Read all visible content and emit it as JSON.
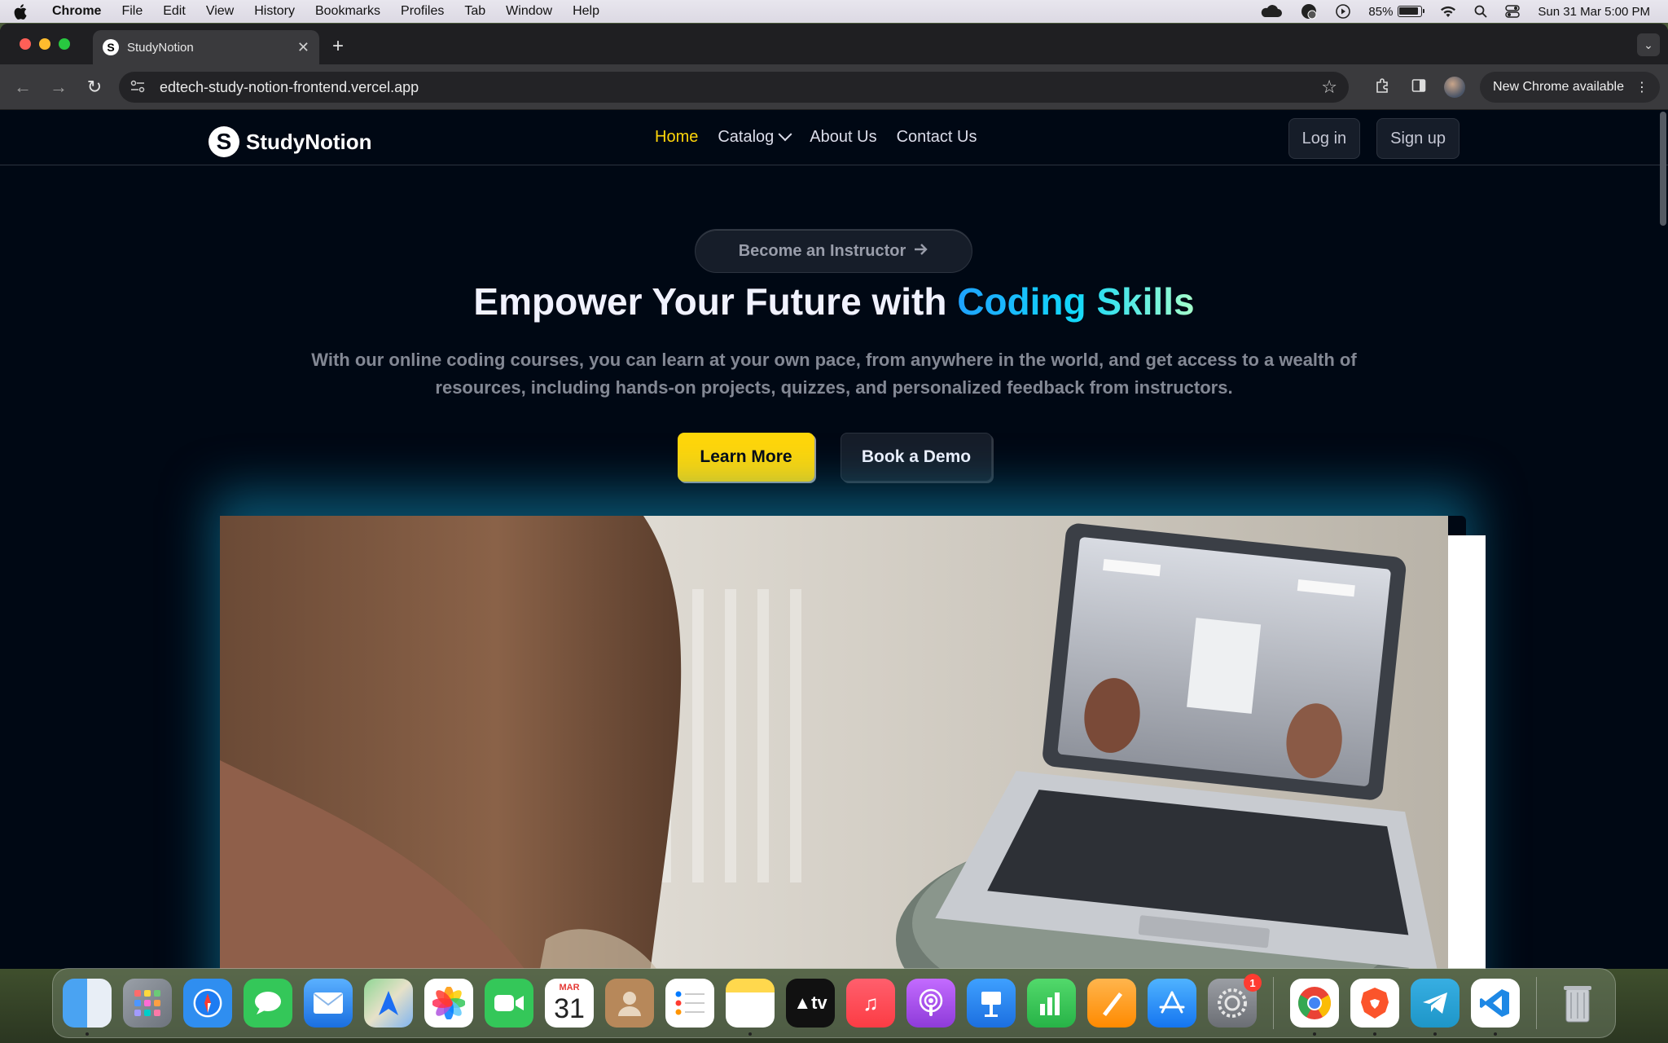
{
  "menubar": {
    "app": "Chrome",
    "items": [
      "File",
      "Edit",
      "View",
      "History",
      "Bookmarks",
      "Profiles",
      "Tab",
      "Window",
      "Help"
    ],
    "battery_percent": "85%",
    "battery_level": 0.85,
    "datetime": "Sun 31 Mar  5:00 PM",
    "status_icons": [
      "cloud-icon",
      "sync-icon",
      "play-icon",
      "wifi-icon",
      "search-icon",
      "control-center-icon"
    ]
  },
  "browser": {
    "tab": {
      "title": "StudyNotion",
      "favicon": "S"
    },
    "url": "edtech-study-notion-frontend.vercel.app",
    "update_button": "New Chrome available"
  },
  "site": {
    "logo": "StudyNotion",
    "logo_mark": "S",
    "nav": {
      "home": "Home",
      "catalog": "Catalog",
      "about": "About Us",
      "contact": "Contact Us"
    },
    "auth": {
      "login": "Log in",
      "signup": "Sign up"
    },
    "hero": {
      "pill": "Become an Instructor",
      "headline_prefix": "Empower Your Future with",
      "headline_highlight": "Coding Skills",
      "subtext": "With our online coding courses, you can learn at your own pace, from anywhere in the world, and get access to a wealth of resources, including hands-on projects, quizzes, and personalized feedback from instructors.",
      "cta_primary": "Learn More",
      "cta_secondary": "Book a Demo"
    },
    "colors": {
      "accent_yellow": "#FFD60A",
      "background": "#000814",
      "gradient_start": "#1FA2FF",
      "gradient_end": "#A6FFCB"
    }
  },
  "dock": {
    "calendar_month": "MAR",
    "calendar_day": "31",
    "settings_badge": "1",
    "tv_label": "tv",
    "apps": [
      "finder",
      "launchpad",
      "safari",
      "messages",
      "mail",
      "maps",
      "photos",
      "facetime",
      "calendar",
      "contacts",
      "reminders",
      "notes",
      "tv",
      "music",
      "podcasts",
      "keynote",
      "numbers",
      "pages",
      "app-store",
      "system-settings",
      "chrome",
      "brave",
      "telegram",
      "vscode",
      "trash"
    ]
  }
}
